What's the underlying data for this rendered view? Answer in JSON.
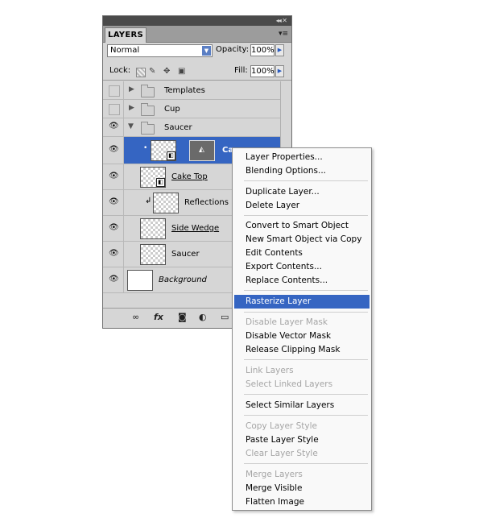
{
  "panel": {
    "tab_label": "LAYERS",
    "blend_mode": "Normal",
    "opacity_label": "Opacity:",
    "opacity_value": "100%",
    "lock_label": "Lock:",
    "fill_label": "Fill:",
    "fill_value": "100%"
  },
  "layers": [
    {
      "name": "Templates",
      "type": "group",
      "visible": false,
      "expanded": false
    },
    {
      "name": "Cup",
      "type": "group",
      "visible": false,
      "expanded": false
    },
    {
      "name": "Saucer",
      "type": "group",
      "visible": true,
      "expanded": true
    },
    {
      "name": "Ca",
      "type": "smart-object",
      "visible": true,
      "selected": true
    },
    {
      "name": "Cake Top",
      "type": "smart-object",
      "visible": true,
      "underlined": true
    },
    {
      "name": "Reflections",
      "type": "layer",
      "visible": true,
      "clipped": true
    },
    {
      "name": "Side Wedge",
      "type": "layer",
      "visible": true,
      "underlined": true
    },
    {
      "name": "Saucer",
      "type": "layer",
      "visible": true
    },
    {
      "name": "Background",
      "type": "background",
      "visible": true,
      "italic": true
    }
  ],
  "menu": {
    "items": [
      {
        "label": "Layer Properties...",
        "enabled": true
      },
      {
        "label": "Blending Options...",
        "enabled": true
      },
      {
        "label": "Duplicate Layer...",
        "enabled": true
      },
      {
        "label": "Delete Layer",
        "enabled": true
      },
      {
        "label": "Convert to Smart Object",
        "enabled": true
      },
      {
        "label": "New Smart Object via Copy",
        "enabled": true
      },
      {
        "label": "Edit Contents",
        "enabled": true
      },
      {
        "label": "Export Contents...",
        "enabled": true
      },
      {
        "label": "Replace Contents...",
        "enabled": true
      },
      {
        "label": "Rasterize Layer",
        "enabled": true,
        "highlighted": true
      },
      {
        "label": "Disable Layer Mask",
        "enabled": false
      },
      {
        "label": "Disable Vector Mask",
        "enabled": true
      },
      {
        "label": "Release Clipping Mask",
        "enabled": true
      },
      {
        "label": "Link Layers",
        "enabled": false
      },
      {
        "label": "Select Linked Layers",
        "enabled": false
      },
      {
        "label": "Select Similar Layers",
        "enabled": true
      },
      {
        "label": "Copy Layer Style",
        "enabled": false
      },
      {
        "label": "Paste Layer Style",
        "enabled": true
      },
      {
        "label": "Clear Layer Style",
        "enabled": false
      },
      {
        "label": "Merge Layers",
        "enabled": false
      },
      {
        "label": "Merge Visible",
        "enabled": true
      },
      {
        "label": "Flatten Image",
        "enabled": true
      }
    ]
  },
  "colors": {
    "highlight": "#3565c2",
    "panel_bg": "#d6d6d6",
    "disabled_text": "#a5a5a5"
  },
  "icons": [
    "eye-icon",
    "folder-icon",
    "link-icon",
    "fx-icon",
    "mask-icon",
    "adjustment-icon",
    "new-group-icon"
  ]
}
